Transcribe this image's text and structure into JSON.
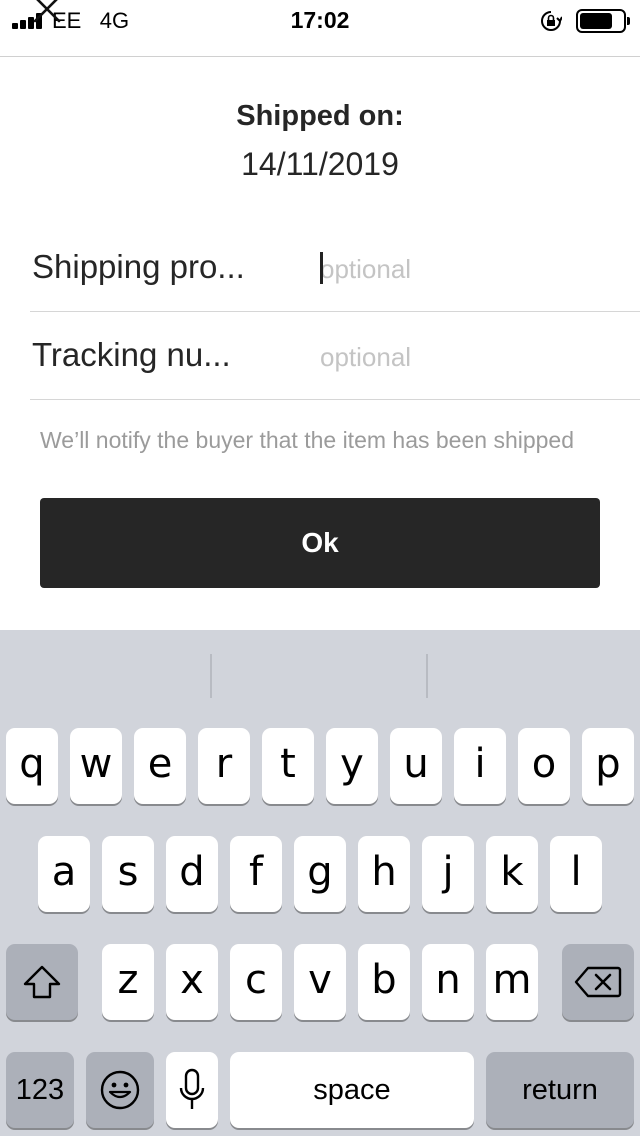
{
  "status_bar": {
    "carrier": "EE",
    "network": "4G",
    "time": "17:02",
    "battery_level": 0.75,
    "icons": [
      "signal-icon",
      "orientation-lock-icon",
      "battery-icon"
    ]
  },
  "header": {
    "close_icon": "close-icon",
    "shipped_label": "Shipped on:",
    "shipped_date": "14/11/2019"
  },
  "form": {
    "shipping_provider": {
      "label": "Shipping pro...",
      "placeholder": "optional",
      "value": ""
    },
    "tracking_number": {
      "label": "Tracking nu...",
      "placeholder": "optional",
      "value": ""
    },
    "notice": "We’ll notify the buyer that the item has been shipped",
    "ok_label": "Ok"
  },
  "keyboard": {
    "row1": [
      "q",
      "w",
      "e",
      "r",
      "t",
      "y",
      "u",
      "i",
      "o",
      "p"
    ],
    "row2": [
      "a",
      "s",
      "d",
      "f",
      "g",
      "h",
      "j",
      "k",
      "l"
    ],
    "row3": [
      "z",
      "x",
      "c",
      "v",
      "b",
      "n",
      "m"
    ],
    "numbers_label": "123",
    "space_label": "space",
    "return_label": "return",
    "icons": [
      "shift-icon",
      "backspace-icon",
      "emoji-icon",
      "microphone-icon"
    ]
  }
}
